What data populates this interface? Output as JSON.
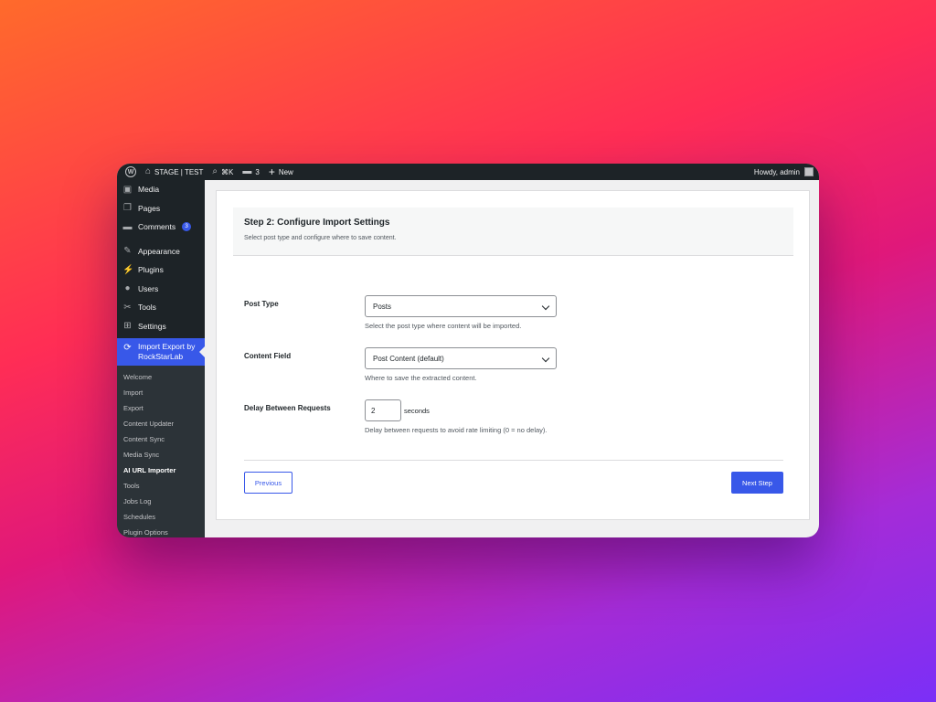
{
  "adminbar": {
    "site_name": "STAGE | TEST",
    "search_shortcut": "⌘K",
    "comments_count": "3",
    "new_label": "New",
    "howdy": "Howdy, admin"
  },
  "sidebar": {
    "items": [
      {
        "label": "Media",
        "icon": "media-icon"
      },
      {
        "label": "Pages",
        "icon": "pages-icon"
      },
      {
        "label": "Comments",
        "icon": "comments-icon",
        "badge": "3"
      },
      {
        "label": "Appearance",
        "icon": "appearance-icon"
      },
      {
        "label": "Plugins",
        "icon": "plugins-icon"
      },
      {
        "label": "Users",
        "icon": "users-icon"
      },
      {
        "label": "Tools",
        "icon": "tools-icon"
      },
      {
        "label": "Settings",
        "icon": "settings-icon"
      }
    ],
    "active": {
      "label_line1": "Import Export by",
      "label_line2": "RockStarLab",
      "icon": "sync-icon"
    },
    "submenu": [
      "Welcome",
      "Import",
      "Export",
      "Content Updater",
      "Content Sync",
      "Media Sync",
      "AI URL Importer",
      "Tools",
      "Jobs Log",
      "Schedules",
      "Plugin Options"
    ],
    "current_submenu": "AI URL Importer"
  },
  "step": {
    "title": "Step 2: Configure Import Settings",
    "description": "Select post type and configure where to save content."
  },
  "form": {
    "post_type": {
      "label": "Post Type",
      "value": "Posts",
      "help": "Select the post type where content will be imported."
    },
    "content_field": {
      "label": "Content Field",
      "value": "Post Content (default)",
      "help": "Where to save the extracted content."
    },
    "delay": {
      "label": "Delay Between Requests",
      "value": "2",
      "unit": "seconds",
      "help": "Delay between requests to avoid rate limiting (0 = no delay)."
    }
  },
  "buttons": {
    "previous": "Previous",
    "next": "Next Step"
  },
  "colors": {
    "accent": "#3858e9",
    "admin_dark": "#1d2327"
  }
}
